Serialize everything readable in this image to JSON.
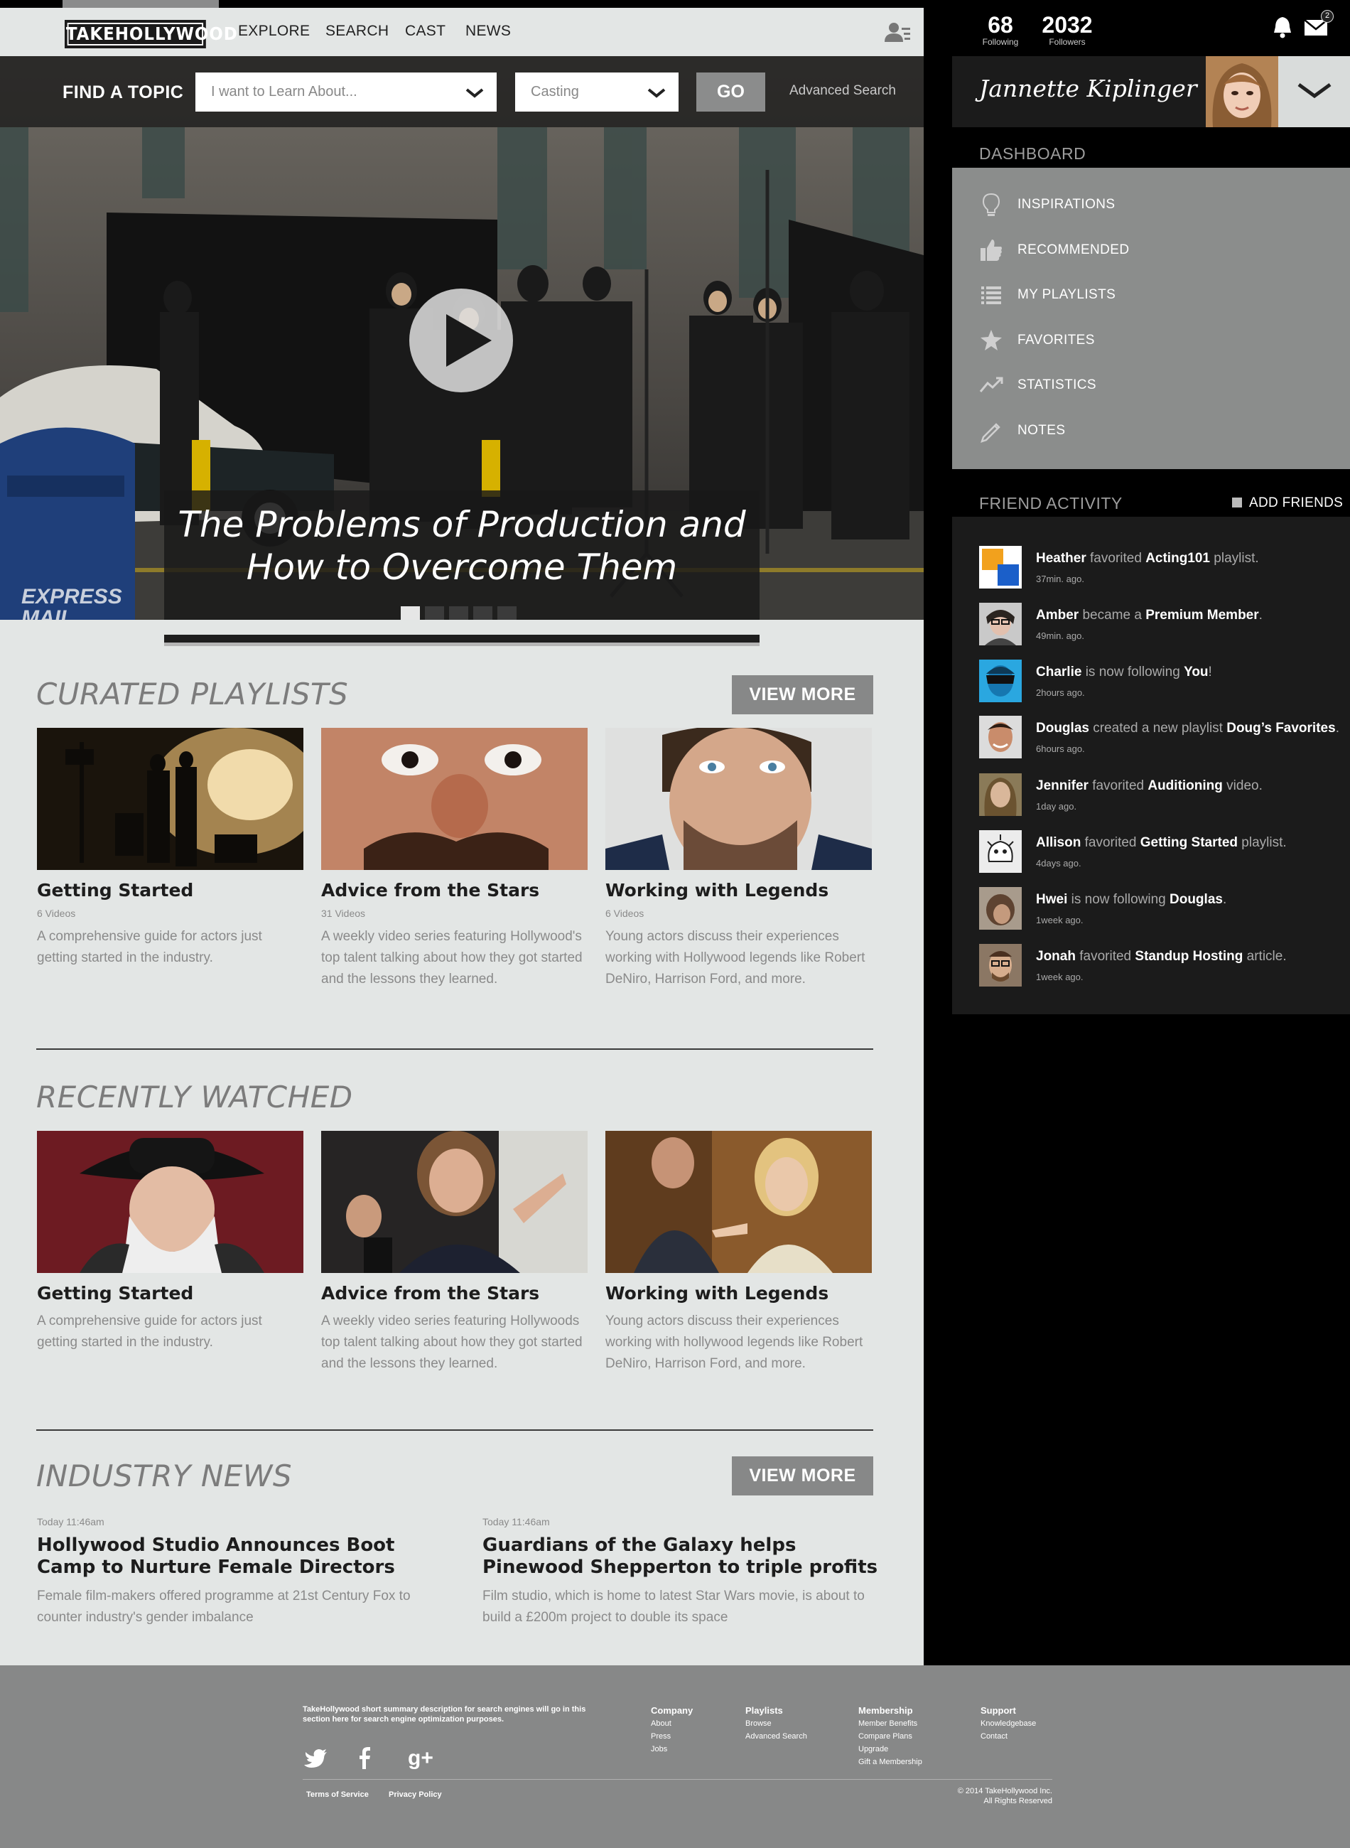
{
  "nav": {
    "logo": "TAKEHOLLYWOOD",
    "links": [
      "EXPLORE",
      "SEARCH",
      "CAST",
      "NEWS"
    ]
  },
  "search": {
    "label": "FIND A TOPIC",
    "topic_placeholder": "I want to Learn About...",
    "category_value": "Casting",
    "go": "GO",
    "advanced": "Advanced Search"
  },
  "hero": {
    "caption_line1": "The Problems of Production and",
    "caption_line2": "How to Overcome Them",
    "slides": 5,
    "active_slide": 1
  },
  "curated": {
    "title": "CURATED PLAYLISTS",
    "view_more": "VIEW MORE",
    "cards": [
      {
        "title": "Getting Started",
        "count": "6 Videos",
        "desc": "A comprehensive guide for actors just getting started in the industry."
      },
      {
        "title": "Advice from the Stars",
        "count": "31 Videos",
        "desc": "A weekly video series featuring Hollywood's top talent talking about how they got started and the lessons they learned."
      },
      {
        "title": "Working with Legends",
        "count": "6 Videos",
        "desc": "Young actors discuss their experiences working with Hollywood legends like Robert DeNiro, Harrison Ford, and more."
      }
    ]
  },
  "recent": {
    "title": "RECENTLY WATCHED",
    "cards": [
      {
        "title": "Getting Started",
        "desc": "A comprehensive guide for actors just getting started in the industry."
      },
      {
        "title": "Advice from the Stars",
        "desc": "A weekly video series featuring Hollywoods top talent talking about how they got started and the lessons they learned."
      },
      {
        "title": "Working with Legends",
        "desc": "Young actors discuss their experiences working with hollywood legends like Robert DeNiro, Harrison Ford, and more."
      }
    ]
  },
  "news": {
    "title": "INDUSTRY NEWS",
    "view_more": "VIEW MORE",
    "items": [
      {
        "time": "Today 11:46am",
        "headline": "Hollywood Studio Announces Boot Camp to Nurture Female Directors",
        "desc": "Female film-makers offered programme at 21st Century Fox to counter industry's gender imbalance"
      },
      {
        "time": "Today 11:46am",
        "headline": "Guardians of the Galaxy helps Pinewood Shepperton to triple profits",
        "desc": "Film studio, which is home to latest Star Wars movie, is about to build a £200m project to double its space"
      }
    ]
  },
  "sidebar": {
    "following": "68",
    "following_label": "Following",
    "followers": "2032",
    "followers_label": "Followers",
    "mail_badge": "2",
    "user_name": "Jannette Kiplinger",
    "dashboard_title": "DASHBOARD",
    "dashboard": [
      {
        "label": "INSPIRATIONS",
        "icon": "lightbulb-icon"
      },
      {
        "label": "RECOMMENDED",
        "icon": "thumbs-up-icon"
      },
      {
        "label": "MY PLAYLISTS",
        "icon": "list-icon"
      },
      {
        "label": "FAVORITES",
        "icon": "star-icon"
      },
      {
        "label": "STATISTICS",
        "icon": "trend-icon"
      },
      {
        "label": "NOTES",
        "icon": "pencil-icon"
      }
    ],
    "friend_title": "FRIEND ACTIVITY",
    "add_friends": "ADD FRIENDS",
    "activity": [
      {
        "name": "Heather",
        "verb": "favorited",
        "obj": "Acting101",
        "tail": "playlist.",
        "time": "37min. ago."
      },
      {
        "name": "Amber",
        "verb": "became a",
        "obj": "Premium Member",
        "tail": ".",
        "time": "49min. ago."
      },
      {
        "name": "Charlie",
        "verb": "is now following",
        "obj": "You",
        "tail": "!",
        "time": "2hours ago."
      },
      {
        "name": "Douglas",
        "verb": "created a new playlist",
        "obj": "Doug’s Favorites",
        "tail": ".",
        "time": "6hours ago."
      },
      {
        "name": "Jennifer",
        "verb": "favorited",
        "obj": "Auditioning",
        "tail": "video.",
        "time": "1day ago."
      },
      {
        "name": "Allison",
        "verb": "favorited",
        "obj": "Getting Started",
        "tail": "playlist.",
        "time": "4days ago."
      },
      {
        "name": "Hwei",
        "verb": "is now following",
        "obj": "Douglas",
        "tail": ".",
        "time": "1week ago."
      },
      {
        "name": "Jonah",
        "verb": "favorited",
        "obj": "Standup Hosting",
        "tail": "article.",
        "time": "1week ago."
      }
    ]
  },
  "footer": {
    "desc": "TakeHollywood short summary description for  search engines will go in this section here for search engine optimization purposes.",
    "cols": [
      {
        "h": "Company",
        "links": [
          "About",
          "Press",
          "Jobs"
        ]
      },
      {
        "h": "Playlists",
        "links": [
          "Browse",
          "Advanced Search"
        ]
      },
      {
        "h": "Membership",
        "links": [
          "Member Benefits",
          "Compare Plans",
          "Upgrade",
          "Gift a Membership"
        ]
      },
      {
        "h": "Support",
        "links": [
          "Knowledgebase",
          "Contact"
        ]
      }
    ],
    "terms": "Terms of Service",
    "privacy": "Privacy Policy",
    "copy1": "© 2014 TakeHollywood Inc.",
    "copy2": "All Rights Reserved"
  }
}
